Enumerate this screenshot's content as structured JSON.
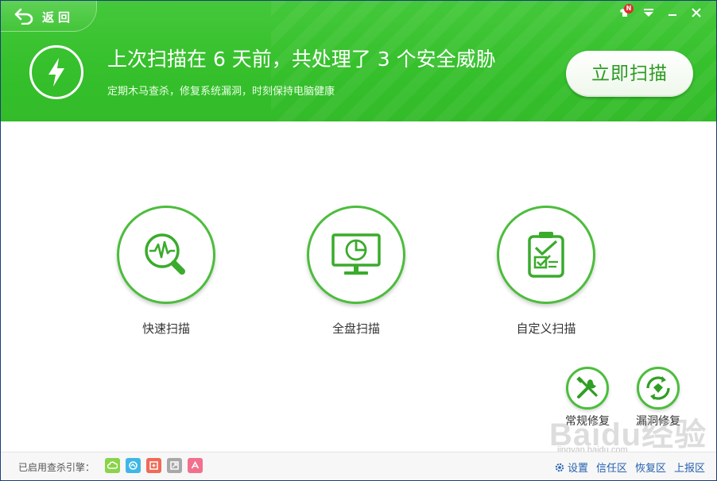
{
  "header": {
    "back_label": "返回",
    "headline": "上次扫描在 6 天前，共处理了 3 个安全威胁",
    "subline": "定期木马查杀，修复系统漏洞，时刻保持电脑健康",
    "scan_now_label": "立即扫描",
    "notification_badge": "N"
  },
  "scan_options": [
    {
      "label": "快速扫描",
      "icon": "quick-scan-icon"
    },
    {
      "label": "全盘扫描",
      "icon": "full-scan-icon"
    },
    {
      "label": "自定义扫描",
      "icon": "custom-scan-icon"
    }
  ],
  "repair_options": [
    {
      "label": "常规修复",
      "icon": "tools-icon"
    },
    {
      "label": "漏洞修复",
      "icon": "vulnerability-repair-icon"
    }
  ],
  "footer": {
    "engines_label": "已启用查杀引擎：",
    "links": [
      "设置",
      "信任区",
      "恢复区",
      "上报区"
    ]
  },
  "watermark": {
    "text": "Baidu经验",
    "url": "jingyan.baidu.com"
  },
  "colors": {
    "brand_green": "#3ac22f",
    "accent_green": "#4cbd3c",
    "link_blue": "#2561b0",
    "engine_colors": [
      "#8bd34a",
      "#3fb7e6",
      "#ef6a57",
      "#a8a8a8",
      "#f26f8d"
    ]
  }
}
